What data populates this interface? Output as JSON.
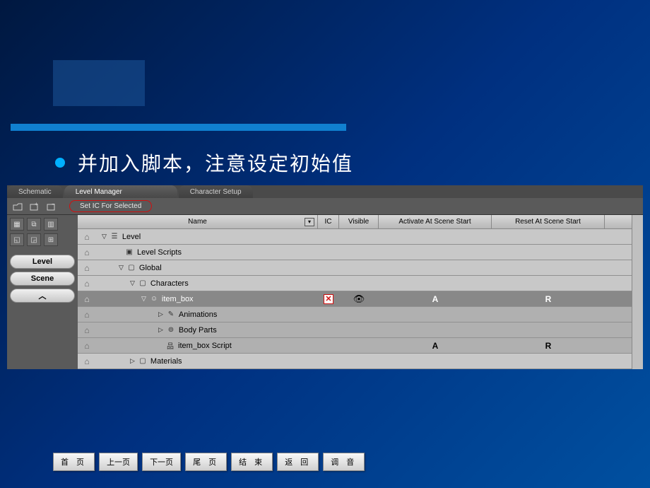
{
  "caption": "并加入脚本，注意设定初始值",
  "tabs": {
    "schematic": "Schematic",
    "level_manager": "Level Manager",
    "character_setup": "Character Setup"
  },
  "toolbar": {
    "set_ic": "Set IC For Selected"
  },
  "sidebar": {
    "level": "Level",
    "scene": "Scene"
  },
  "columns": {
    "name": "Name",
    "ic": "IC",
    "visible": "Visible",
    "activate": "Activate At Scene Start",
    "reset": "Reset At Scene Start"
  },
  "tree": {
    "level": "Level",
    "level_scripts": "Level Scripts",
    "global": "Global",
    "characters": "Characters",
    "item_box": "item_box",
    "animations": "Animations",
    "body_parts": "Body Parts",
    "item_box_script": "item_box Script",
    "materials": "Materials"
  },
  "flags": {
    "A": "A",
    "R": "R"
  },
  "nav": {
    "first": "首 页",
    "prev": "上一页",
    "next": "下一页",
    "last": "尾 页",
    "end": "结 束",
    "back": "返 回",
    "audio": "调 音"
  }
}
